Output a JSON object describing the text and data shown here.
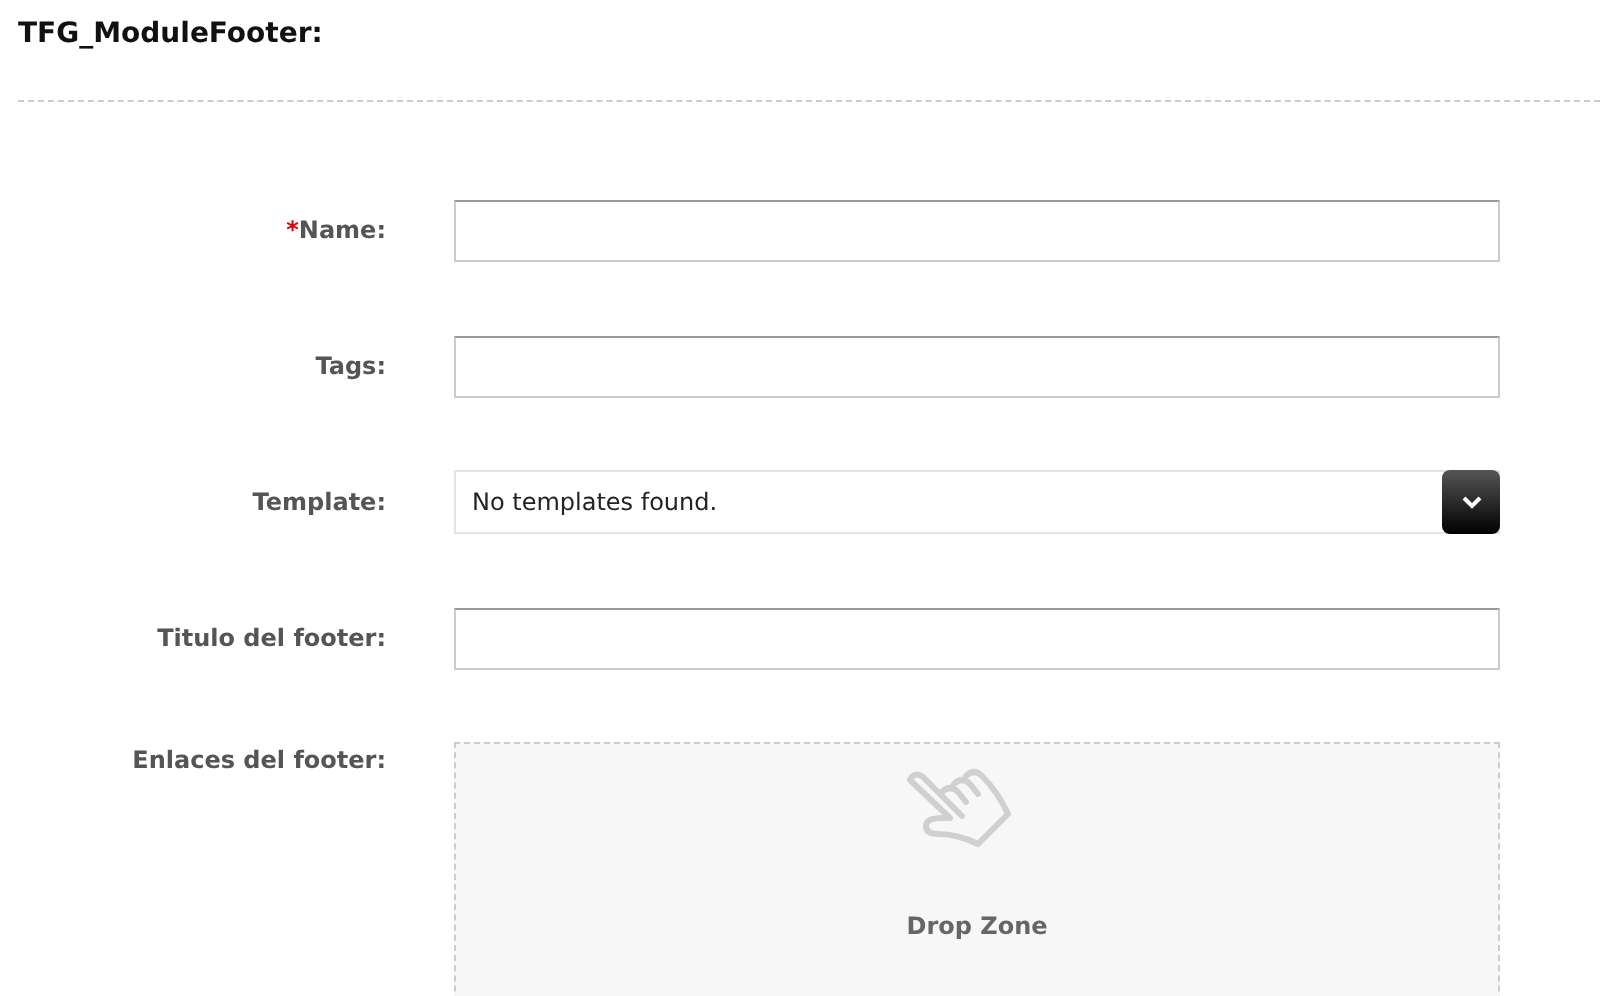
{
  "title": "TFG_ModuleFooter:",
  "fields": [
    {
      "kind": "text",
      "label": "Name:",
      "required_mark": "*"
    },
    {
      "kind": "text",
      "label": "Tags:"
    },
    {
      "kind": "select",
      "label": "Template:",
      "value": "No templates found."
    },
    {
      "kind": "text",
      "label": "Titulo del footer:"
    },
    {
      "kind": "dropzone",
      "label": "Enlaces del footer:",
      "text": "Drop Zone"
    }
  ]
}
